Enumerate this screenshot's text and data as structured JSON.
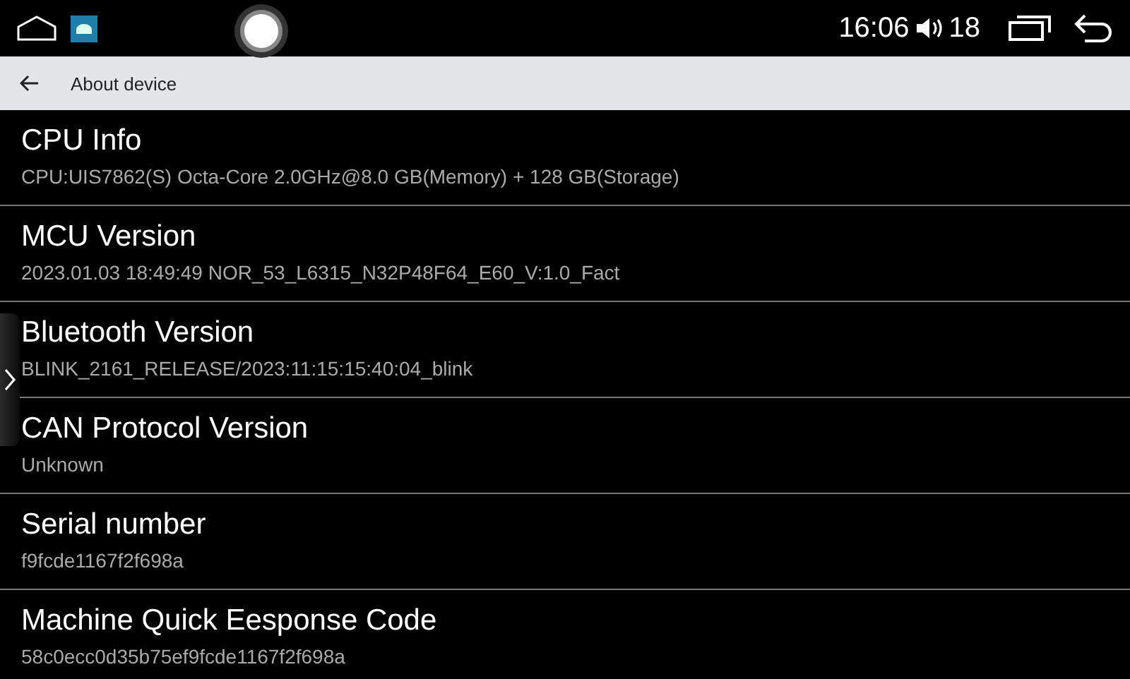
{
  "status_bar": {
    "time": "16:06",
    "volume": "18"
  },
  "header": {
    "title": "About device"
  },
  "items": [
    {
      "title": "CPU Info",
      "value": "CPU:UIS7862(S) Octa-Core 2.0GHz@8.0 GB(Memory) + 128 GB(Storage)"
    },
    {
      "title": "MCU Version",
      "value": "2023.01.03 18:49:49 NOR_53_L6315_N32P48F64_E60_V:1.0_Fact"
    },
    {
      "title": "Bluetooth Version",
      "value": "BLINK_2161_RELEASE/2023:11:15:15:40:04_blink"
    },
    {
      "title": "CAN Protocol Version",
      "value": "Unknown"
    },
    {
      "title": "Serial number",
      "value": "f9fcde1167f2f698a"
    },
    {
      "title": "Machine Quick Eesponse Code",
      "value": "58c0ecc0d35b75ef9fcde1167f2f698a"
    }
  ]
}
